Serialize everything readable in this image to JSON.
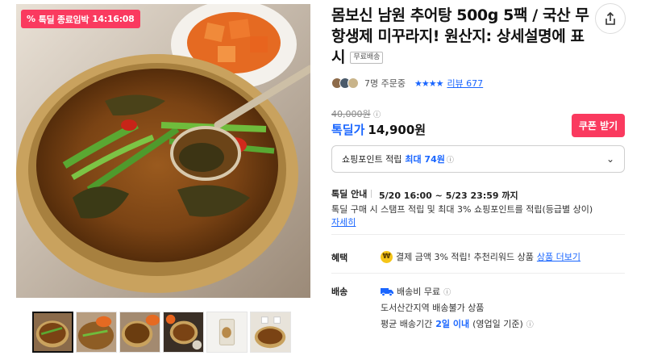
{
  "gallery": {
    "badge_text": "톡딜 종료임박",
    "badge_time": "14:16:08",
    "thumb_count": 6,
    "active_thumb": 1
  },
  "product": {
    "title": "몸보신 남원 추어탕 500g 5팩 / 국산 무항생제 미꾸라지! 원산지: 상세설명에 표시",
    "shipping_tag": "무료배송",
    "buyers": "7명 주문중",
    "stars": "★★★★",
    "review_label": "리뷰 677",
    "original_price": "40,000원",
    "deal_label": "톡딜가",
    "deal_price": "14,900원",
    "coupon_label": "쿠폰 받기"
  },
  "points": {
    "label": "쇼핑포인트 적립",
    "max": "최대 74원"
  },
  "guide": {
    "label": "톡딜 안내",
    "period": "5/20 16:00 ~ 5/23 23:59 까지",
    "desc": "톡딜 구매 시 스탬프 적립 및 최대 3% 쇼핑포인트를 적립(등급별 상이)",
    "more": "자세히"
  },
  "benefit": {
    "label": "혜택",
    "icon_text": "₩",
    "text": "결제 금액 3% 적립! 추천리워드 상품",
    "more": "상품 더보기"
  },
  "shipping": {
    "label": "배송",
    "fee": "배송비 무료",
    "restriction": "도서산간지역 배송불가 상품",
    "period_prefix": "평균 배송기간",
    "period_value": "2일 이내",
    "period_suffix": "(영업일 기준)"
  },
  "colors": {
    "accent_red": "#fa3a5f",
    "accent_blue": "#1a66ff"
  }
}
